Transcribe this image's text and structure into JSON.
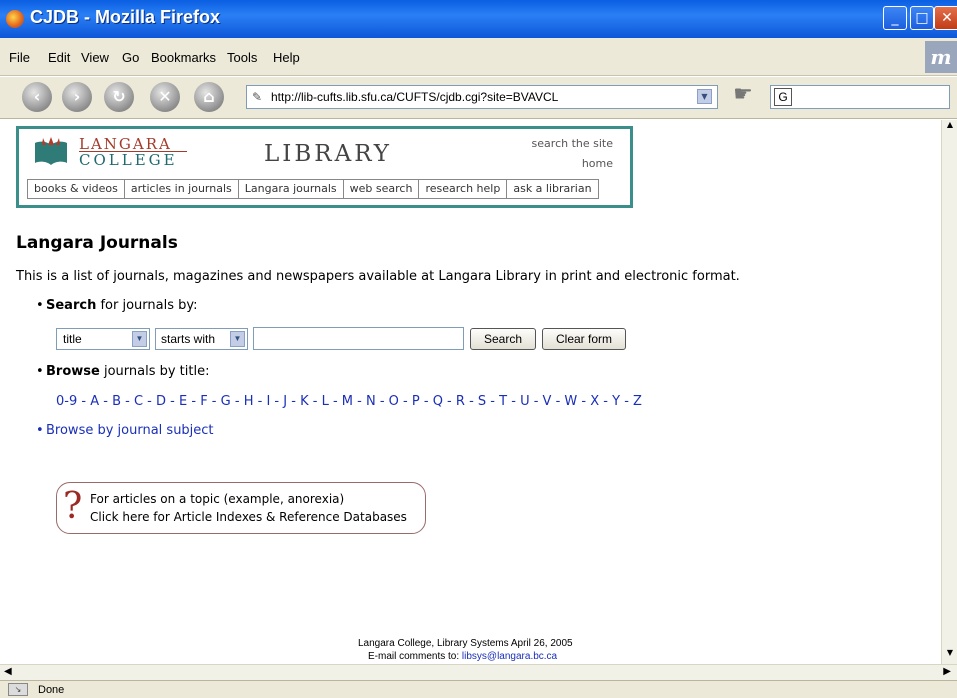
{
  "window": {
    "title": "CJDB - Mozilla Firefox"
  },
  "menu": [
    "File",
    "Edit",
    "View",
    "Go",
    "Bookmarks",
    "Tools",
    "Help"
  ],
  "nav": {
    "url": "http://lib-cufts.lib.sfu.ca/CUFTS/cjdb.cgi?site=BVAVCL"
  },
  "header": {
    "logo_line1": "LANGARA",
    "logo_line2": "COLLEGE",
    "library": "LIBRARY",
    "search_site": "search the site",
    "home": "home",
    "tabs": [
      "books & videos",
      "articles in journals",
      "Langara journals",
      "web search",
      "research help",
      "ask a librarian"
    ]
  },
  "main": {
    "title": "Langara Journals",
    "intro": "This is a list of journals, magazines and newspapers available at Langara Library in print and electronic format.",
    "search_bold": "Search",
    "search_rest": " for journals by:",
    "field_select": "title",
    "op_select": "starts with",
    "query_value": "",
    "search_button": "Search",
    "clear_button": "Clear form",
    "browse_bold": "Browse",
    "browse_rest": " journals by title:",
    "alphabet": [
      "0-9",
      "A",
      "B",
      "C",
      "D",
      "E",
      "F",
      "G",
      "H",
      "I",
      "J",
      "K",
      "L",
      "M",
      "N",
      "O",
      "P",
      "Q",
      "R",
      "S",
      "T",
      "U",
      "V",
      "W",
      "X",
      "Y",
      "Z"
    ],
    "browse_subject": "Browse by journal subject",
    "article_line1": "For articles on a topic (example, anorexia)",
    "article_line2": "Click here for Article Indexes & Reference Databases",
    "footer_line1": "Langara College, Library Systems April 26, 2005",
    "footer_prefix": "E-mail comments to: ",
    "footer_email": "libsys@langara.bc.ca"
  },
  "status": {
    "text": "Done"
  }
}
